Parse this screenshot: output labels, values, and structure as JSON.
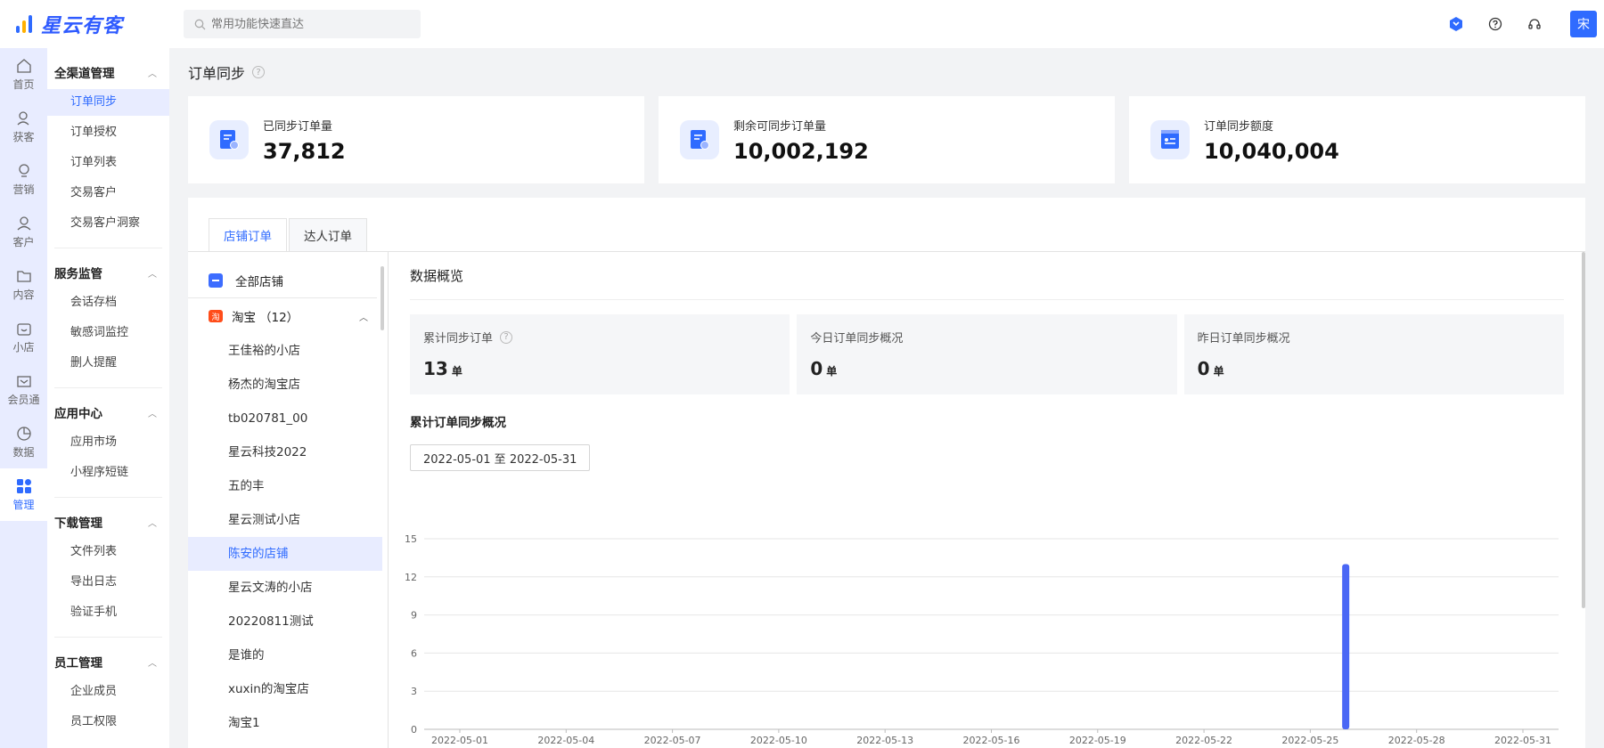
{
  "brand": {
    "name": "星云有客"
  },
  "search": {
    "placeholder": "常用功能快速直达"
  },
  "user": {
    "avatar_text": "宋"
  },
  "rail": [
    {
      "label": "首页",
      "icon": "home-icon"
    },
    {
      "label": "获客",
      "icon": "user-add-icon"
    },
    {
      "label": "营销",
      "icon": "bulb-icon"
    },
    {
      "label": "客户",
      "icon": "user-icon"
    },
    {
      "label": "内容",
      "icon": "folder-icon"
    },
    {
      "label": "小店",
      "icon": "shop-icon"
    },
    {
      "label": "会员通",
      "icon": "member-icon"
    },
    {
      "label": "数据",
      "icon": "pie-icon"
    },
    {
      "label": "管理",
      "icon": "grid-icon",
      "active": true
    }
  ],
  "menu": {
    "groups": [
      {
        "title": "全渠道管理",
        "items": [
          "订单同步",
          "订单授权",
          "订单列表",
          "交易客户",
          "交易客户洞察"
        ]
      },
      {
        "title": "服务监管",
        "items": [
          "会话存档",
          "敏感词监控",
          "删人提醒"
        ]
      },
      {
        "title": "应用中心",
        "items": [
          "应用市场",
          "小程序短链"
        ]
      },
      {
        "title": "下载管理",
        "items": [
          "文件列表",
          "导出日志",
          "验证手机"
        ]
      },
      {
        "title": "员工管理",
        "items": [
          "企业成员",
          "员工权限"
        ]
      }
    ],
    "active_item": "订单同步"
  },
  "page": {
    "title": "订单同步"
  },
  "stats": [
    {
      "label": "已同步订单量",
      "value": "37,812"
    },
    {
      "label": "剩余可同步订单量",
      "value": "10,002,192"
    },
    {
      "label": "订单同步额度",
      "value": "10,040,004"
    }
  ],
  "tabs": [
    {
      "label": "店铺订单",
      "active": true
    },
    {
      "label": "达人订单",
      "active": false
    }
  ],
  "shops": {
    "all_label": "全部店铺",
    "platform": "淘宝",
    "platform_count": "（12）",
    "platform_icon_text": "淘",
    "items": [
      "王佳裕的小店",
      "杨杰的淘宝店",
      "tb020781_00",
      "星云科技2022",
      "五的丰",
      "星云测试小店",
      "陈安的店铺",
      "星云文涛的小店",
      "20220811测试",
      "是谁的",
      "xuxin的淘宝店",
      "淘宝1"
    ],
    "active": "陈安的店铺"
  },
  "overview": {
    "title": "数据概览",
    "cards": [
      {
        "label": "累计同步订单",
        "value": "13",
        "unit": "单",
        "help": true
      },
      {
        "label": "今日订单同步概况",
        "value": "0",
        "unit": "单",
        "help": false
      },
      {
        "label": "昨日订单同步概况",
        "value": "0",
        "unit": "单",
        "help": false
      }
    ],
    "cumulative_title": "累计订单同步概况",
    "date_range": "2022-05-01 至 2022-05-31"
  },
  "chart_data": {
    "type": "bar",
    "x_ticks": [
      "2022-05-01",
      "2022-05-04",
      "2022-05-07",
      "2022-05-10",
      "2022-05-13",
      "2022-05-16",
      "2022-05-19",
      "2022-05-22",
      "2022-05-25",
      "2022-05-28",
      "2022-05-31"
    ],
    "y_ticks": [
      0,
      3,
      6,
      9,
      12,
      15
    ],
    "ylim": [
      0,
      15
    ],
    "xlim": [
      "2022-05-01",
      "2022-05-31"
    ],
    "points": [
      {
        "x": "2022-05-26",
        "y": 13
      }
    ],
    "color": "#4a67f5",
    "grid": true
  }
}
